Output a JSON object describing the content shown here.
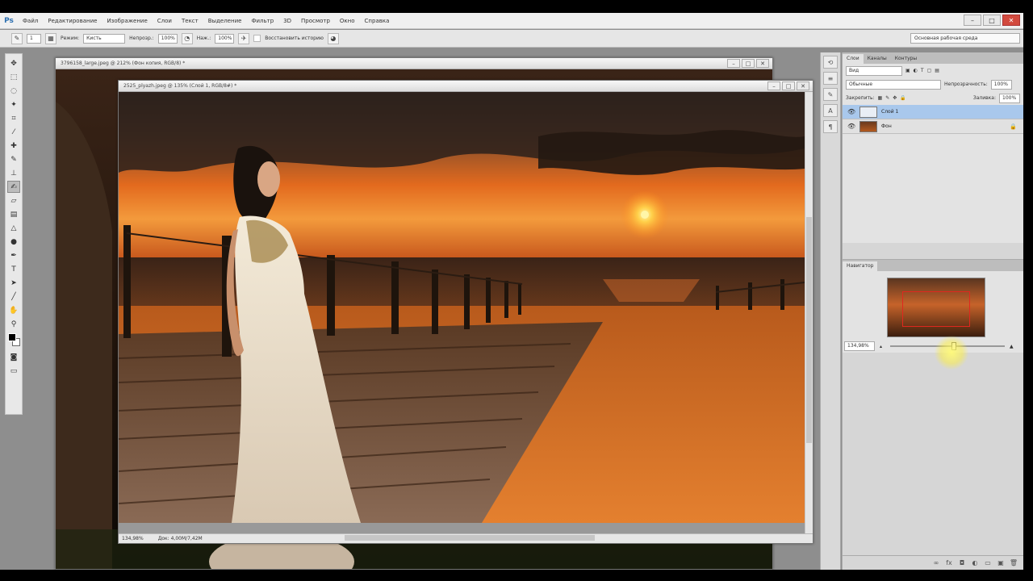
{
  "app": {
    "logo": "Ps"
  },
  "menu": [
    "Файл",
    "Редактирование",
    "Изображение",
    "Слои",
    "Текст",
    "Выделение",
    "Фильтр",
    "3D",
    "Просмотр",
    "Окно",
    "Справка"
  ],
  "window_controls": {
    "minimize": "–",
    "maximize": "□",
    "close": "✕"
  },
  "options": {
    "size_value": "1",
    "mode_label": "Режим:",
    "mode_value": "Кисть",
    "opacity_label": "Непрозр.:",
    "opacity_value": "100%",
    "flow_label": "Наж.:",
    "flow_value": "100%",
    "history_label": "Восстановить историю",
    "workspace": "Основная рабочая среда"
  },
  "doc_back": {
    "title": "3796158_large.jpeg @ 212% (Фон копия, RGB/8) *"
  },
  "doc_front": {
    "title": "2525_plyazh.jpeg @ 135% (Слой 1, RGB/8#) *",
    "zoom": "134,98%",
    "doc_info": "Док: 4,00M/7,42M"
  },
  "layers_panel": {
    "tabs": [
      "Слои",
      "Каналы",
      "Контуры"
    ],
    "kind_filter": "Вид",
    "blend_mode": "Обычные",
    "opacity_label": "Непрозрачность:",
    "opacity_value": "100%",
    "lock_label": "Закрепить:",
    "fill_label": "Заливка:",
    "fill_value": "100%",
    "layers": [
      {
        "name": "Слой 1",
        "selected": true
      },
      {
        "name": "Фон",
        "selected": false,
        "locked": true
      }
    ]
  },
  "navigator": {
    "tab": "Навигатор",
    "zoom": "134,98%"
  },
  "colors": {
    "accent": "#2b6fb0",
    "selected_layer": "#a9c8ec",
    "nav_frame": "#e0281e"
  }
}
